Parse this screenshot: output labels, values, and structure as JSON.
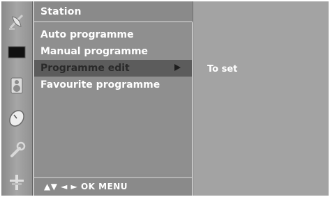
{
  "menu": {
    "title": "Station",
    "items": [
      {
        "label": "Auto programme",
        "selected": false
      },
      {
        "label": "Manual programme",
        "selected": false
      },
      {
        "label": "Programme edit",
        "selected": true
      },
      {
        "label": "Favourite programme",
        "selected": false
      }
    ],
    "nav_hint": "▲▼  ◄ ►  OK  MENU"
  },
  "info": {
    "text": "To set"
  },
  "icons": [
    {
      "name": "satellite-dish-icon",
      "active": true
    },
    {
      "name": "picture-icon",
      "active": false
    },
    {
      "name": "speaker-icon",
      "active": false
    },
    {
      "name": "clock-icon",
      "active": false
    },
    {
      "name": "wrench-icon",
      "active": false
    },
    {
      "name": "input-source-icon",
      "active": false
    }
  ],
  "colors": {
    "selected_row": "#5c5c5c",
    "menu_background": "#8f8f8f",
    "info_background": "#a3a3a3"
  }
}
